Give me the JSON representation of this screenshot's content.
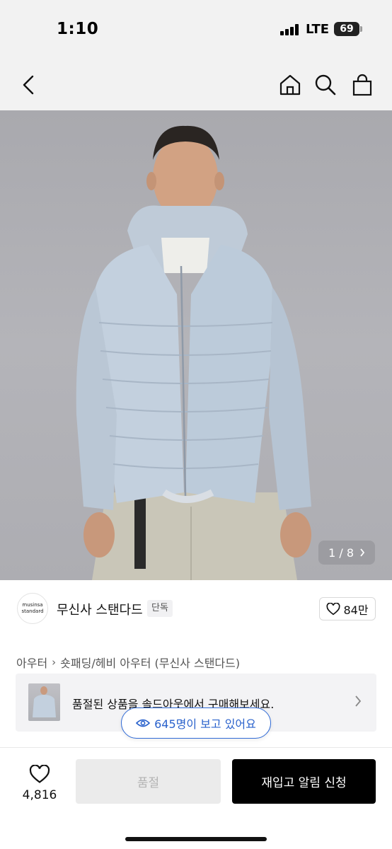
{
  "status": {
    "time": "1:10",
    "network": "LTE",
    "battery": "69"
  },
  "nav": {
    "back_icon": "chevron-left-icon",
    "home_icon": "home-icon",
    "search_icon": "search-icon",
    "bag_icon": "bag-icon"
  },
  "product": {
    "image_counter": "1 / 8"
  },
  "brand": {
    "logo_line1": "musinsa",
    "logo_line2": "standard",
    "name": "무신사 스탠다드",
    "badge": "단독",
    "likes": "84만"
  },
  "breadcrumb": {
    "items": [
      "아우터",
      "숏패딩/헤비 아우터 (무신사 스탠다드)"
    ]
  },
  "soldout_banner": {
    "text": "품절된 상품을 솔드아웃에서 구매해보세요."
  },
  "viewers": {
    "text": "645명이 보고 있어요"
  },
  "bottom": {
    "wish_count": "4,816",
    "soldout_label": "품절",
    "restock_label": "재입고 알림 신청"
  },
  "colors": {
    "accent_blue": "#2f6ad6",
    "primary_black": "#000000",
    "disabled_gray": "#ebebeb"
  }
}
